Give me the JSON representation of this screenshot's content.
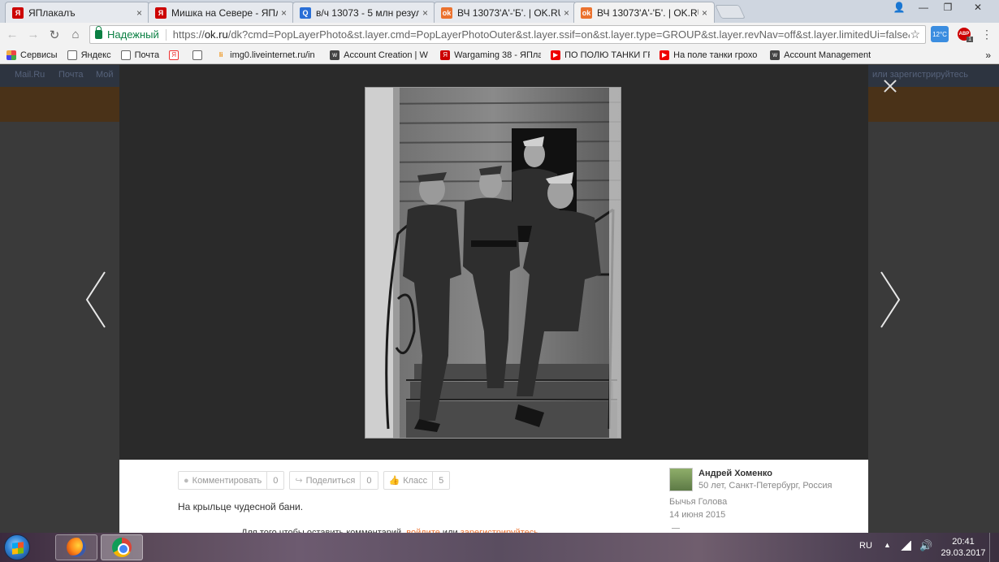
{
  "tabs": [
    {
      "title": "ЯПлакалъ",
      "icon": "yaplakal-icon",
      "active": false
    },
    {
      "title": "Мишка на Севере - ЯПл",
      "icon": "yaplakal-icon",
      "active": false
    },
    {
      "title": "в/ч 13073 - 5 млн резул",
      "icon": "search-icon",
      "active": false
    },
    {
      "title": "ВЧ 13073'А'-'Б'. | OK.RU",
      "icon": "ok-icon",
      "active": false
    },
    {
      "title": "ВЧ 13073'А'-'Б'. | OK.RU",
      "icon": "ok-icon",
      "active": true
    }
  ],
  "tab_close_glyph": "×",
  "window_controls": {
    "minimize": "—",
    "maximize": "❐",
    "close": "✕",
    "user": "👤"
  },
  "omnibox": {
    "secure_label": "Надежный",
    "url_scheme": "https://",
    "url_host": "ok.ru",
    "url_path": "/dk?cmd=PopLayerPhoto&st.layer.cmd=PopLayerPhotoOuter&st.layer.ssif=on&st.layer.type=GROUP&st.layer.revNav=off&st.layer.limitedUi=false&st."
  },
  "extensions": {
    "weather": "12°C",
    "adblock_label": "ABP",
    "adblock_badge": "1"
  },
  "bookmarks": [
    {
      "label": "Сервисы",
      "icon": "apps-icon"
    },
    {
      "label": "Яндекс",
      "icon": "page-icon"
    },
    {
      "label": "Почта",
      "icon": "page-icon"
    },
    {
      "label": "",
      "icon": "yandex-icon"
    },
    {
      "label": "",
      "icon": "page-icon"
    },
    {
      "label": "img0.liveinternet.ru/in",
      "icon": "liveinternet-icon"
    },
    {
      "label": "Account Creation | W",
      "icon": "wargaming-icon"
    },
    {
      "label": "Wargaming 38 - ЯПла",
      "icon": "yaplakal-icon"
    },
    {
      "label": "ПО ПОЛЮ ТАНКИ ГР",
      "icon": "youtube-icon"
    },
    {
      "label": "На поле танки грохо",
      "icon": "youtube-icon"
    },
    {
      "label": "Account Management",
      "icon": "wargaming-icon"
    }
  ],
  "bookmarks_more": "»",
  "page_header": {
    "mail": "Mail.Ru",
    "pochta": "Почта",
    "moi": "Мой",
    "register": "или зарегистрируйтесь"
  },
  "photo_actions": [
    {
      "label": "Комментировать",
      "count": "0",
      "icon": "comment-icon"
    },
    {
      "label": "Поделиться",
      "count": "0",
      "icon": "share-icon"
    },
    {
      "label": "Класс",
      "count": "5",
      "icon": "like-icon"
    }
  ],
  "caption": "На крыльце чудесной бани.",
  "login_hint": {
    "prefix": "Для того чтобы оставить комментарий,",
    "login": "войдите",
    "or": "или",
    "register": "зарегистрируйтесь"
  },
  "author": {
    "name": "Андрей Хоменко",
    "meta": "50 лет, Санкт-Петербург, Россия",
    "album": "Бычья Голова",
    "date": "14 июня 2015"
  },
  "taskbar": {
    "lang": "RU",
    "time": "20:41",
    "date": "29.03.2017"
  },
  "colors": {
    "ok_orange": "#eb722e",
    "secure_green": "#0b8043"
  }
}
